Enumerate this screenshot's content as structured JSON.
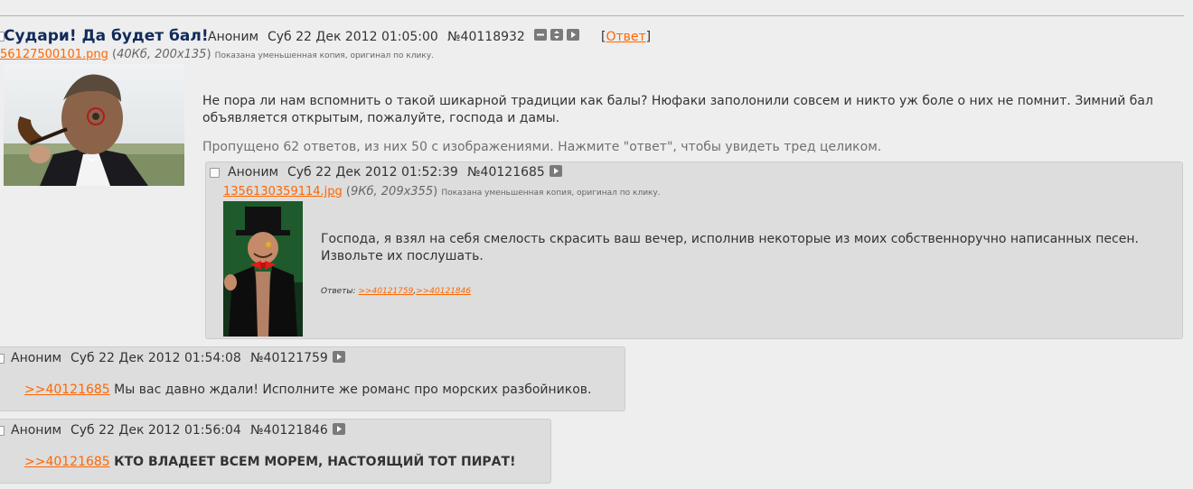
{
  "op": {
    "subject": "Судари! Да будет бал!",
    "name": "Аноним",
    "date": "Суб 22 Дек 2012 01:05:00",
    "number": "№40118932",
    "reply_bracket_open": "[",
    "reply_link": "Ответ",
    "reply_bracket_close": "]",
    "file_name": "56127500101.png",
    "file_meta_open": "(",
    "file_size_dims": "40Кб, 200x135",
    "file_meta_close": ")",
    "file_note": "Показана уменьшенная копия, оригинал по клику.",
    "message_line1": "Не пора ли нам вспомнить о такой шикарной традиции как балы? Нюфаки заполонили совсем и никто уж боле о них не помнит. Зимний бал",
    "message_line2": "объявляется открытым, пожалуйте, господа и дамы.",
    "omitted": "Пропущено 62 ответов, из них 50 с изображениями. Нажмите \"ответ\", чтобы увидеть тред целиком.",
    "icons": [
      "minus-icon",
      "expand-icon",
      "play-icon"
    ]
  },
  "replies": [
    {
      "name": "Аноним",
      "date": "Суб 22 Дек 2012 01:52:39",
      "number": "№40121685",
      "file_name": "1356130359114.jpg",
      "file_size_dims": "9Кб, 209x355",
      "file_note": "Показана уменьшенная копия, оригинал по клику.",
      "message_line1": "Господа, я взял на себя смелость скрасить ваш вечер, исполнив некоторые из моих собственноручно написанных песен.",
      "message_line2": "Извольте их послушать.",
      "answers_label": "Ответы:",
      "answers": [
        ">>40121759",
        ">>40121846"
      ]
    },
    {
      "name": "Аноним",
      "date": "Суб 22 Дек 2012 01:54:08",
      "number": "№40121759",
      "quote": ">>40121685",
      "message": "Мы вас давно ждали! Исполните же романс про морских разбойников."
    },
    {
      "name": "Аноним",
      "date": "Суб 22 Дек 2012 01:56:04",
      "number": "№40121846",
      "quote": ">>40121685",
      "message": "КТО ВЛАДЕЕТ ВСЕМ МОРЕМ, НАСТОЯЩИЙ ТОТ ПИРАТ!"
    }
  ],
  "colors": {
    "background": "#eeeeee",
    "reply_bg": "#dddddd",
    "link": "#ff6600",
    "subject": "#102a5a",
    "text": "#333333"
  }
}
